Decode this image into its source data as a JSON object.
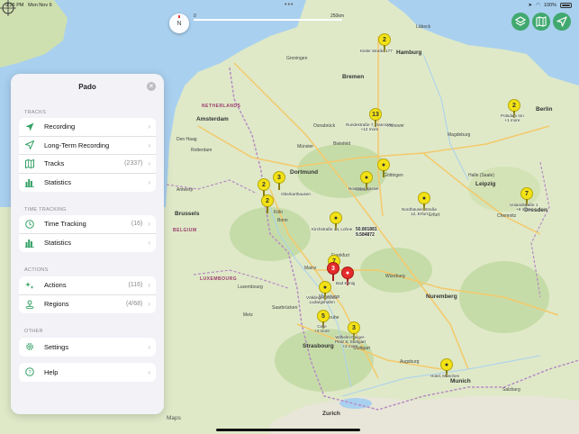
{
  "status_bar": {
    "time": "9:26 PM",
    "date": "Mon Nov 6",
    "battery": "100%"
  },
  "map": {
    "scale_start": "0",
    "scale_end": "250km",
    "compass": "N",
    "attribution": "Maps",
    "coordinate": [
      "50.801881",
      "9.584872"
    ],
    "countries": [
      "NETHERLANDS",
      "BELGIUM",
      "LUXEMBOURG"
    ],
    "cities": [
      "Amsterdam",
      "Den Haag",
      "Rotterdam",
      "Antwerp",
      "Brussels",
      "Dortmund",
      "Köln",
      "Bonn",
      "Bremen",
      "Hanover",
      "Göttingen",
      "Kassel",
      "Erfurt",
      "Leipzig",
      "Dresden",
      "Magdeburg",
      "Berlin",
      "Frankfurt",
      "Mainz",
      "Würzburg",
      "Nuremberg",
      "Stuttgart",
      "Munich",
      "Augsburg",
      "Strasbourg",
      "Zurich",
      "Salzburg",
      "Luxembourg",
      "Lübeck",
      "Hamburg",
      "Groningen",
      "Halle (Saale)",
      "Chemnitz",
      "Karlsruhe",
      "Mannheim",
      "Saarbrücken",
      "Metz",
      "Osnabrück",
      "Münster",
      "Bielefeld"
    ],
    "pins": [
      {
        "label": "2",
        "caption": [
          "Kieler Straße 177"
        ]
      },
      {
        "label": "2",
        "caption": [
          "Potsdam Inn",
          "+1 more"
        ]
      },
      {
        "label": "13",
        "caption": [
          "Rundestraße 7, Hannover",
          "+12 more"
        ]
      },
      {
        "label": "",
        "caption": [
          "Göttingen"
        ]
      },
      {
        "label": "",
        "caption": [
          "Novostar Kassel"
        ]
      },
      {
        "label": "",
        "caption": [
          "Nordhäuser Straße",
          "12, Erfurt"
        ]
      },
      {
        "label": "7",
        "caption": [
          "Uniandstraße 1",
          "+6 more"
        ]
      },
      {
        "label": "3",
        "caption": [
          "Oberkarthausen"
        ]
      },
      {
        "label": "2",
        "caption": []
      },
      {
        "label": "2",
        "caption": [
          "Köln"
        ]
      },
      {
        "label": "",
        "caption": [
          "Kirchstraße 14, Lohne"
        ]
      },
      {
        "label": "7",
        "caption": []
      },
      {
        "label": "3",
        "caption": []
      },
      {
        "label": "",
        "caption": [
          "Bad König"
        ]
      },
      {
        "label": "",
        "caption": [
          "Völklinger Straße",
          "Ludwigshafen"
        ]
      },
      {
        "label": "5",
        "caption": [
          "Celle",
          "+4 more"
        ]
      },
      {
        "label": "3",
        "caption": [
          "Wilhelm-Geiger-",
          "Platz 8, Stuttgart",
          "+2 more"
        ]
      },
      {
        "label": "",
        "caption": [
          "Hotel, München"
        ]
      }
    ]
  },
  "sidebar": {
    "title": "Pado",
    "sections": {
      "tracks": "TRACKS",
      "time_tracking": "TIME TRACKING",
      "actions": "ACTIONS",
      "other": "OTHER"
    },
    "tracks": [
      {
        "label": "Recording",
        "count": ""
      },
      {
        "label": "Long-Term Recording",
        "count": ""
      },
      {
        "label": "Tracks",
        "count": "(2337)"
      },
      {
        "label": "Statistics",
        "count": ""
      }
    ],
    "time_tracking": [
      {
        "label": "Time Tracking",
        "count": "(16)"
      },
      {
        "label": "Statistics",
        "count": ""
      }
    ],
    "actions": [
      {
        "label": "Actions",
        "count": "(116)"
      },
      {
        "label": "Regions",
        "count": "(4/68)"
      }
    ],
    "other": [
      {
        "label": "Settings",
        "count": ""
      },
      {
        "label": "Help",
        "count": ""
      }
    ]
  },
  "colors": {
    "accent": "#34a165",
    "pin_yellow": "#f2e216",
    "pin_red": "#e32b2b"
  }
}
